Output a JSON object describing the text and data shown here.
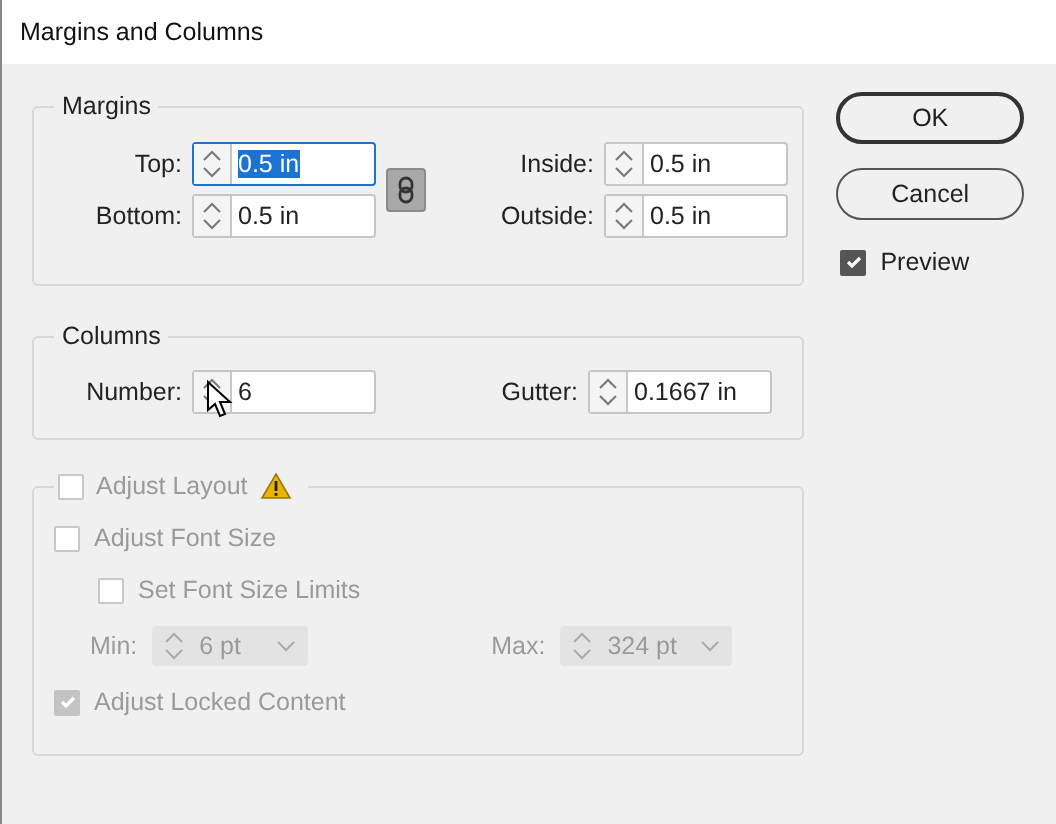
{
  "window": {
    "title": "Margins and Columns"
  },
  "margins": {
    "title": "Margins",
    "link": {
      "on": true
    },
    "fields": [
      {
        "label": "Top:",
        "value": "0.5 in",
        "selected": true
      },
      {
        "label": "Inside:",
        "value": "0.5 in",
        "selected": false
      },
      {
        "label": "Bottom:",
        "value": "0.5 in",
        "selected": false
      },
      {
        "label": "Outside:",
        "value": "0.5 in",
        "selected": false
      }
    ]
  },
  "columns": {
    "title": "Columns",
    "fields": [
      {
        "label": "Number:",
        "value": "6",
        "selected": false
      },
      {
        "label": "Gutter:",
        "value": "0.1667 in",
        "selected": false
      }
    ]
  },
  "adjust_layout": {
    "label": "Adjust Layout",
    "checked": false,
    "disabled": true,
    "font_size": {
      "label": "Adjust Font Size",
      "checked": false
    },
    "font_limits": {
      "label": "Set Font Size Limits",
      "checked": false
    },
    "min": {
      "label": "Min:",
      "value": "6 pt"
    },
    "max": {
      "label": "Max:",
      "value": "324 pt"
    },
    "locked": {
      "label": "Adjust Locked Content",
      "checked": true
    }
  },
  "buttons": [
    {
      "label": "OK",
      "default": true
    },
    {
      "label": "Cancel",
      "default": false
    }
  ],
  "preview": {
    "label": "Preview",
    "checked": true
  }
}
